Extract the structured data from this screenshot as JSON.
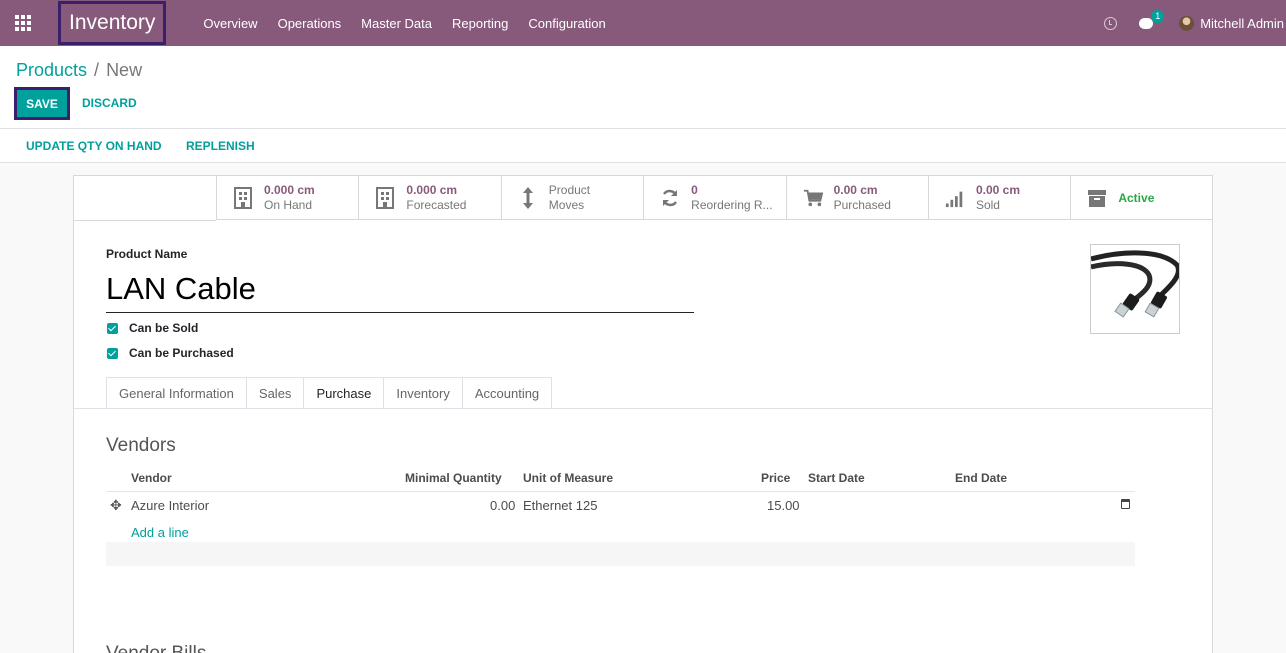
{
  "navbar": {
    "app_name": "Inventory",
    "menu": [
      "Overview",
      "Operations",
      "Master Data",
      "Reporting",
      "Configuration"
    ],
    "chat_count": "1",
    "user": "Mitchell Admin"
  },
  "breadcrumb": {
    "parent": "Products",
    "separator": "/",
    "current": "New"
  },
  "buttons": {
    "save": "SAVE",
    "discard": "DISCARD"
  },
  "statusbar": {
    "update_qty": "UPDATE QTY ON HAND",
    "replenish": "REPLENISH"
  },
  "stat_buttons": [
    {
      "icon": "building-icon",
      "value": "0.000 cm",
      "label": "On Hand"
    },
    {
      "icon": "building-icon",
      "value": "0.000 cm",
      "label": "Forecasted"
    },
    {
      "icon": "arrows-vertical-icon",
      "value": "Product",
      "label": "Moves"
    },
    {
      "icon": "refresh-icon",
      "value": "0",
      "label": "Reordering R..."
    },
    {
      "icon": "cart-icon",
      "value": "0.00 cm",
      "label": "Purchased"
    },
    {
      "icon": "signal-icon",
      "value": "0.00 cm",
      "label": "Sold"
    },
    {
      "icon": "archive-icon",
      "value": "Active",
      "label": ""
    }
  ],
  "form": {
    "product_name_label": "Product Name",
    "product_name": "LAN Cable",
    "can_be_sold": "Can be Sold",
    "can_be_purchased": "Can be Purchased"
  },
  "tabs": [
    "General Information",
    "Sales",
    "Purchase",
    "Inventory",
    "Accounting"
  ],
  "vendors": {
    "title": "Vendors",
    "headers": [
      "Vendor",
      "Minimal Quantity",
      "Unit of Measure",
      "Price",
      "Start Date",
      "End Date"
    ],
    "rows": [
      {
        "vendor": "Azure Interior",
        "min_qty": "0.00",
        "uom": "Ethernet 125",
        "price": "15.00",
        "start": "",
        "end": ""
      }
    ],
    "add_line": "Add a line"
  },
  "vendor_bills": {
    "title": "Vendor Bills"
  },
  "colors": {
    "navbar": "#875a7b",
    "accent": "#00a09d",
    "active": "#28a745"
  }
}
